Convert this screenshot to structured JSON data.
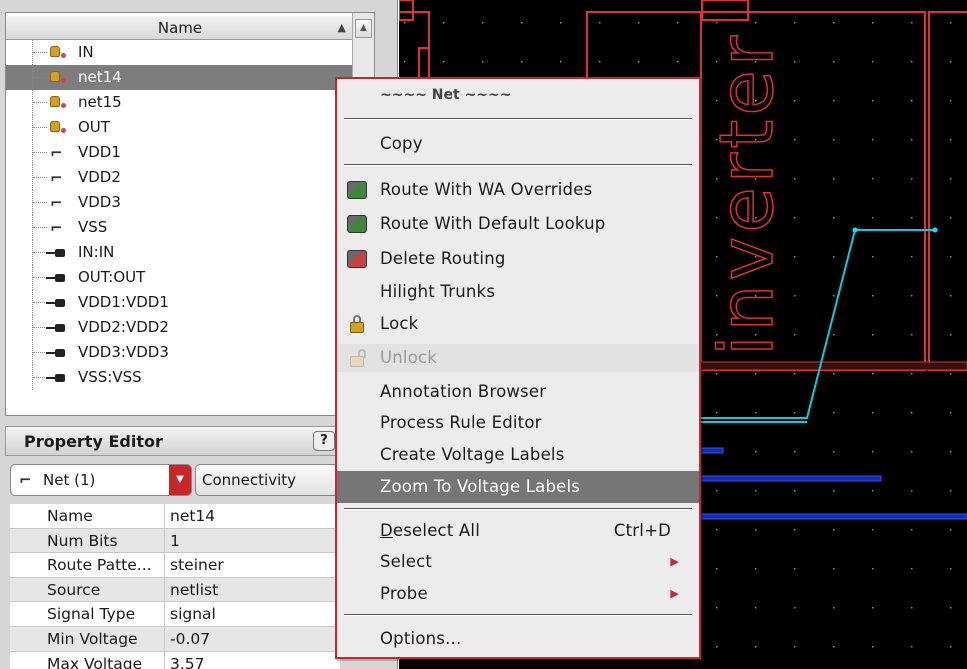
{
  "tree": {
    "header": "Name",
    "items": [
      {
        "label": "IN",
        "kind": "net"
      },
      {
        "label": "net14",
        "kind": "net",
        "selected": true
      },
      {
        "label": "net15",
        "kind": "net"
      },
      {
        "label": "OUT",
        "kind": "net"
      },
      {
        "label": "VDD1",
        "kind": "power"
      },
      {
        "label": "VDD2",
        "kind": "power"
      },
      {
        "label": "VDD3",
        "kind": "power"
      },
      {
        "label": "VSS",
        "kind": "power"
      },
      {
        "label": "IN:IN",
        "kind": "pin"
      },
      {
        "label": "OUT:OUT",
        "kind": "pin"
      },
      {
        "label": "VDD1:VDD1",
        "kind": "pin"
      },
      {
        "label": "VDD2:VDD2",
        "kind": "pin"
      },
      {
        "label": "VDD3:VDD3",
        "kind": "pin"
      },
      {
        "label": "VSS:VSS",
        "kind": "pin"
      }
    ]
  },
  "property_editor": {
    "title": "Property Editor",
    "help": "?",
    "net_select": "Net (1)",
    "category_select": "Connectivity",
    "rows": [
      {
        "key": "Name",
        "value": "net14"
      },
      {
        "key": "Num Bits",
        "value": "1"
      },
      {
        "key": "Route Patte...",
        "value": "steiner"
      },
      {
        "key": "Source",
        "value": "netlist"
      },
      {
        "key": "Signal Type",
        "value": "signal"
      },
      {
        "key": "Min Voltage",
        "value": "-0.07"
      },
      {
        "key": "Max Voltage",
        "value": "3.57"
      }
    ]
  },
  "canvas": {
    "cell_label": "inverter",
    "colors": {
      "background": "#000000",
      "boundary": "#e03030",
      "wire": "#00d0e0",
      "metal": "#2040d0"
    }
  },
  "context_menu": {
    "title": "~~~~ Net ~~~~",
    "items": {
      "copy": "Copy",
      "route_wa": "Route With WA Overrides",
      "route_default": "Route With Default Lookup",
      "delete_routing": "Delete Routing",
      "hilight_trunks": "Hilight Trunks",
      "lock": "Lock",
      "unlock": "Unlock",
      "annotation_browser": "Annotation Browser",
      "process_rule_editor": "Process Rule Editor",
      "create_voltage_labels": "Create Voltage Labels",
      "zoom_voltage_labels": "Zoom To Voltage Labels",
      "deselect_all_rest": "eselect All",
      "deselect_all_mnemonic": "D",
      "deselect_shortcut": "Ctrl+D",
      "select": "Select",
      "probe": "Probe",
      "options": "Options..."
    }
  }
}
